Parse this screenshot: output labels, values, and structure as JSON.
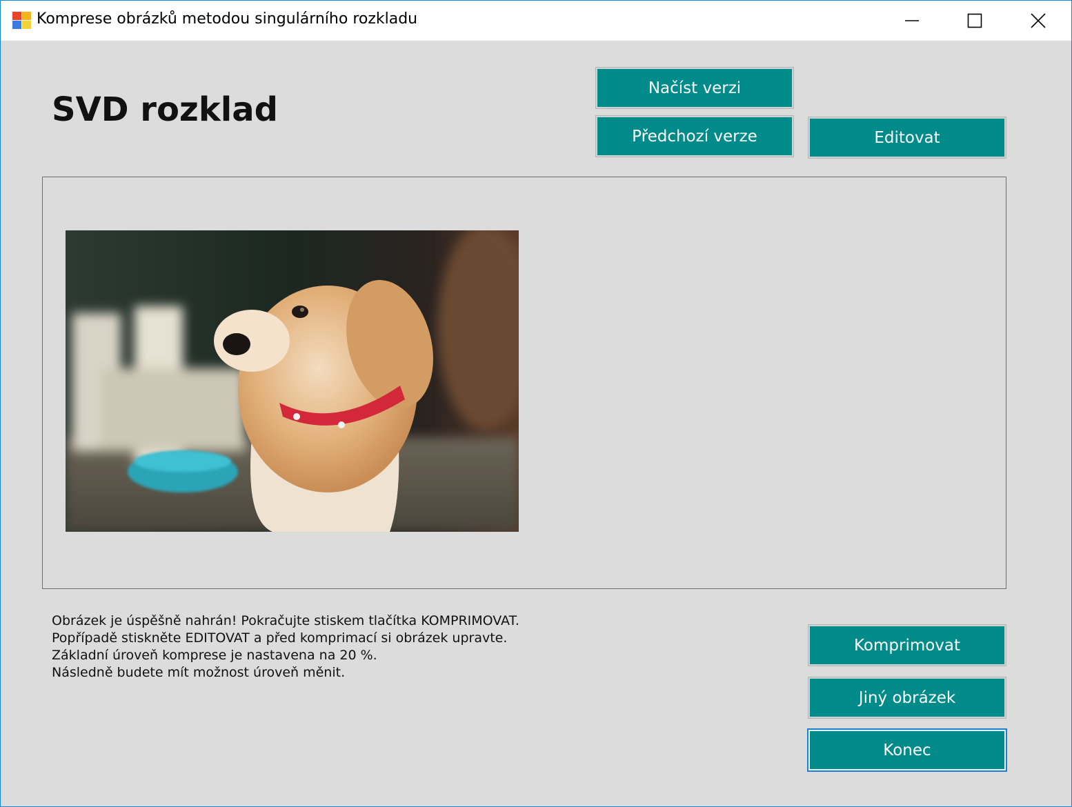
{
  "window": {
    "title": "Komprese obrázků metodou singulárního rozkladu",
    "icon": "app-icon",
    "controls": {
      "minimize": "minimize-icon",
      "maximize": "maximize-icon",
      "close": "close-icon"
    }
  },
  "header": {
    "title": "SVD rozklad"
  },
  "toolbar": {
    "load_version_label": "Načíst verzi",
    "previous_version_label": "Předchozí verze",
    "edit_label": "Editovat"
  },
  "status": {
    "lines": [
      "Obrázek je úspěšně nahrán! Pokračujte stiskem tlačítka KOMPRIMOVAT.",
      "Popřípadě stiskněte EDITOVAT a před komprimací si obrázek upravte.",
      "Základní úroveň komprese je nastavena na 20 %.",
      "Následně budete mít možnost úroveň měnit."
    ]
  },
  "actions": {
    "compress_label": "Komprimovat",
    "other_image_label": "Jiný obrázek",
    "exit_label": "Konec"
  },
  "colors": {
    "accent": "#008b8b",
    "background": "#dcdcdc",
    "focus": "#1c7fd0"
  }
}
